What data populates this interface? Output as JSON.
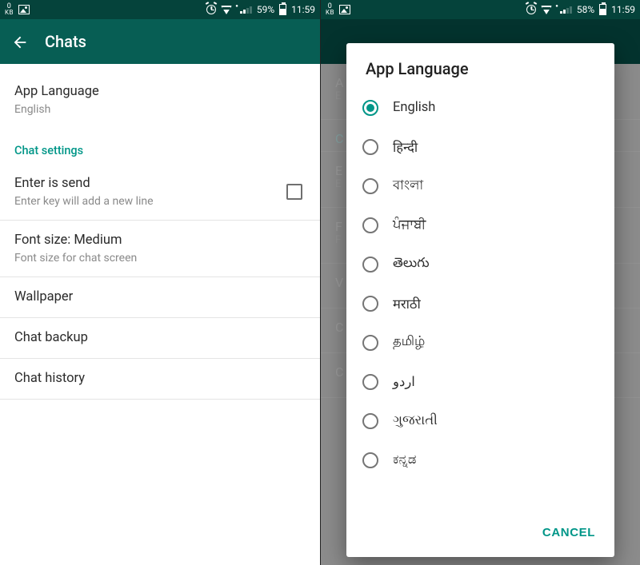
{
  "left": {
    "status": {
      "kb_top": "0",
      "kb_bot": "KB",
      "battery_pct": "59%",
      "clock": "11:59"
    },
    "appbar": {
      "title": "Chats"
    },
    "app_language": {
      "title": "App Language",
      "value": "English"
    },
    "section_label": "Chat settings",
    "items": {
      "enter_send": {
        "title": "Enter is send",
        "sub": "Enter key will add a new line"
      },
      "font_size": {
        "title": "Font size: Medium",
        "sub": "Font size for chat screen"
      },
      "wallpaper": {
        "title": "Wallpaper"
      },
      "backup": {
        "title": "Chat backup"
      },
      "history": {
        "title": "Chat history"
      }
    }
  },
  "right": {
    "status": {
      "kb_top": "0",
      "kb_bot": "KB",
      "battery_pct": "58%",
      "clock": "11:59"
    },
    "dialog": {
      "title": "App Language",
      "options": [
        "English",
        "हिन्दी",
        "বাংলা",
        "ਪੰਜਾਬੀ",
        "తెలుగు",
        "मराठी",
        "தமிழ்",
        "اردو",
        "ગુજરાતી",
        "ಕನ್ನಡ"
      ],
      "selected_index": 0,
      "cancel": "CANCEL"
    }
  }
}
